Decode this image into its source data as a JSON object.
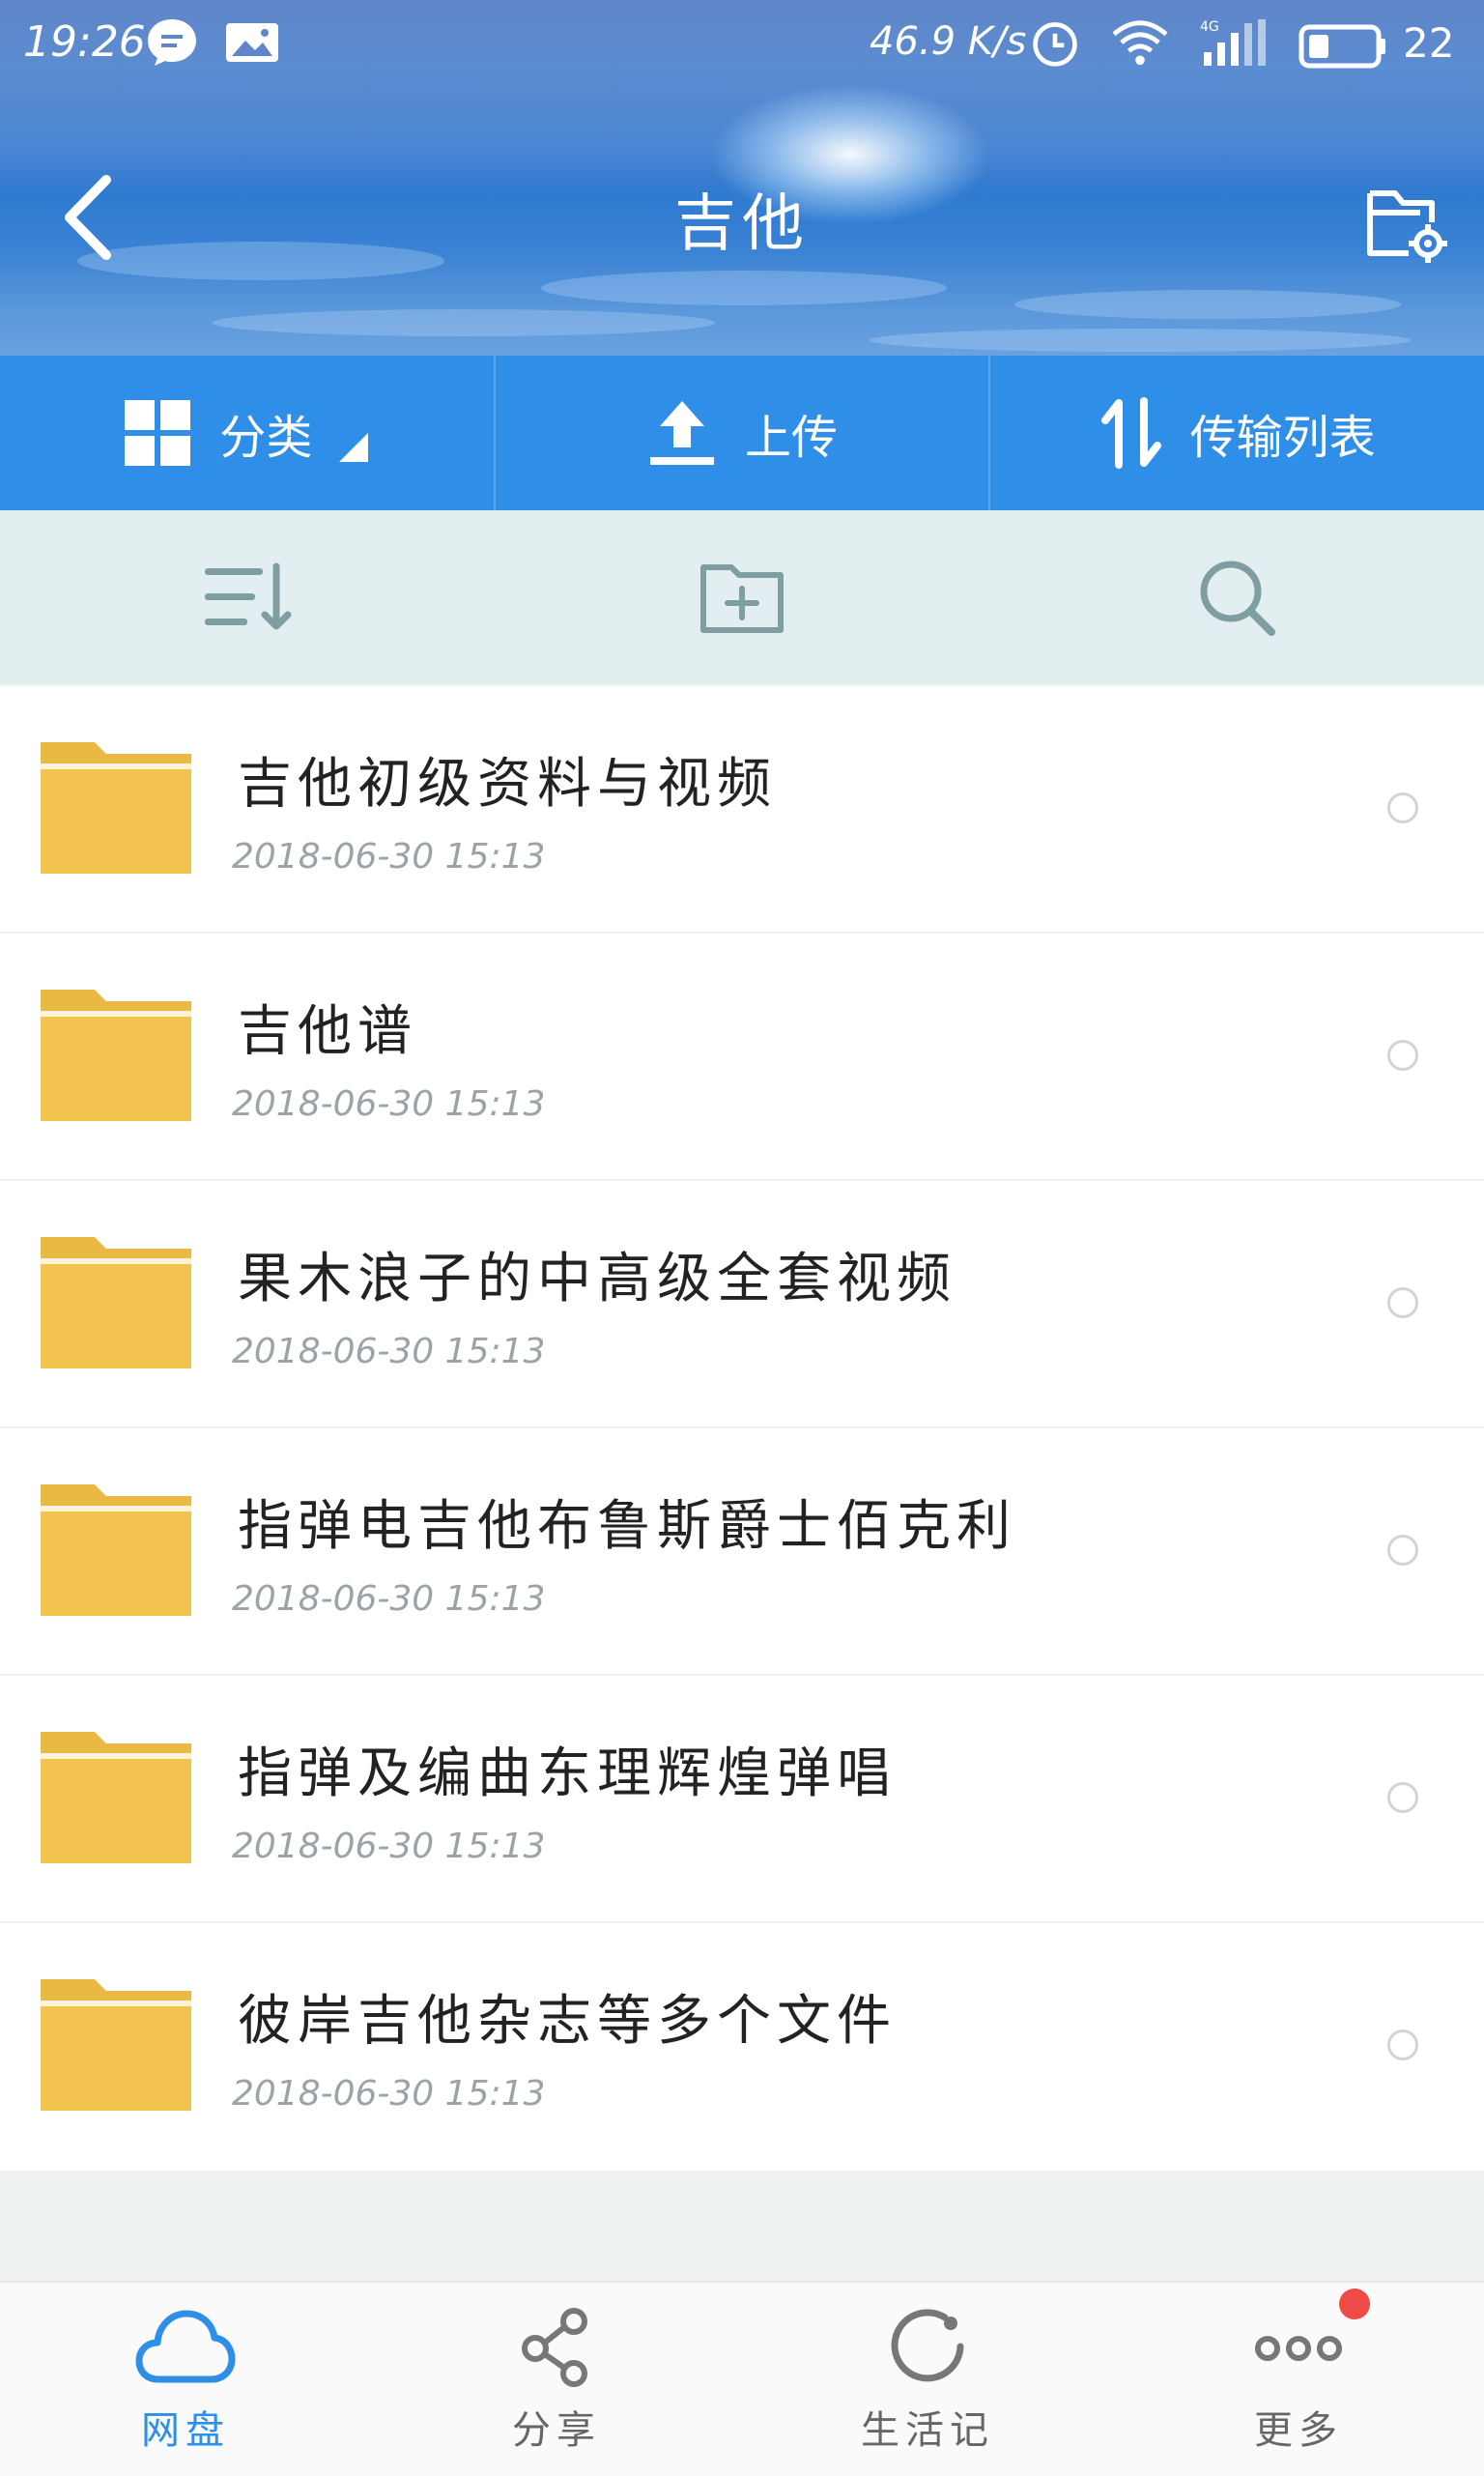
{
  "status_bar": {
    "time": "19:26",
    "net_speed": "46.9 K/s",
    "network": "4G",
    "battery": "22"
  },
  "header": {
    "title": "吉他"
  },
  "action_bar": {
    "items": [
      {
        "label": "分类"
      },
      {
        "label": "上传"
      },
      {
        "label": "传输列表"
      }
    ]
  },
  "files": [
    {
      "name": "吉他初级资料与视频",
      "date": "2018-06-30  15:13"
    },
    {
      "name": "吉他谱",
      "date": "2018-06-30  15:13"
    },
    {
      "name": "果木浪子的中高级全套视频",
      "date": "2018-06-30  15:13"
    },
    {
      "name": "指弹电吉他布鲁斯爵士佰克利",
      "date": "2018-06-30  15:13"
    },
    {
      "name": "指弹及编曲东理辉煌弹唱",
      "date": "2018-06-30  15:13"
    },
    {
      "name": "彼岸吉他杂志等多个文件",
      "date": "2018-06-30  15:13"
    }
  ],
  "bottom_nav": {
    "items": [
      {
        "label": "网盘",
        "icon": "cloud-icon",
        "active": true
      },
      {
        "label": "分享",
        "icon": "share-icon",
        "active": false
      },
      {
        "label": "生活记",
        "icon": "refresh-icon",
        "active": false
      },
      {
        "label": "更多",
        "icon": "more-icon",
        "active": false
      }
    ]
  },
  "colors": {
    "accent": "#2f8ee8",
    "folder": "#f2c44f",
    "toolbar_bg": "#e3eef0",
    "badge": "#ef4a46"
  }
}
